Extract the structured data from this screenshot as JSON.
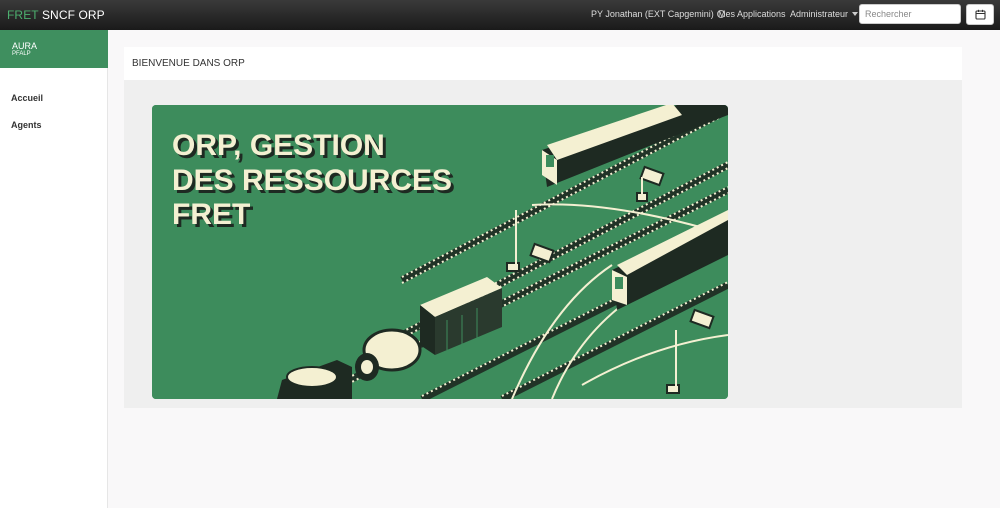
{
  "header": {
    "brand_fret": "FRET",
    "brand_rest": " SNCF ORP",
    "user": "PY Jonathan (EXT Capgemini)",
    "apps_link": "Mes Applications",
    "admin_menu": "Administrateur",
    "search_placeholder": "Rechercher",
    "calendar_icon": "calendar-icon"
  },
  "sidebar": {
    "region": {
      "name": "AURA",
      "code": "PFALP"
    },
    "items": [
      {
        "label": "Accueil"
      },
      {
        "label": "Agents"
      }
    ]
  },
  "main": {
    "title": "BIENVENUE DANS ORP",
    "banner": {
      "line1": "ORP, GESTION",
      "line2": "DES RESSOURCES",
      "line3": "FRET"
    }
  },
  "colors": {
    "brand_green": "#3f8f5f",
    "banner_green": "#3d8c5c",
    "banner_ink": "#1e2a22",
    "banner_light": "#f4f0d2"
  }
}
